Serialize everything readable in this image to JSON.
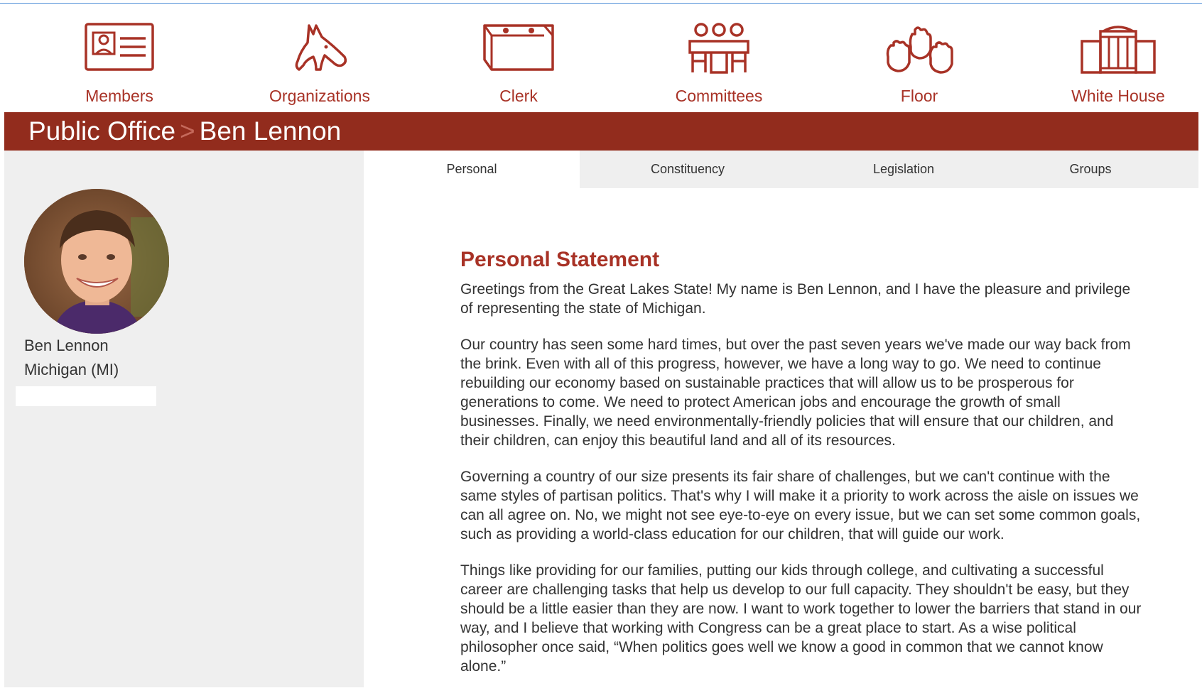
{
  "nav": {
    "items": [
      {
        "label": "Members",
        "icon": "id-card-icon"
      },
      {
        "label": "Organizations",
        "icon": "donkey-icon"
      },
      {
        "label": "Clerk",
        "icon": "file-box-icon"
      },
      {
        "label": "Committees",
        "icon": "committee-icon"
      },
      {
        "label": "Floor",
        "icon": "raised-hands-icon"
      },
      {
        "label": "White House",
        "icon": "building-icon"
      }
    ]
  },
  "title_bar": {
    "section": "Public Office",
    "separator": ">",
    "member": "Ben Lennon"
  },
  "sidebar": {
    "name": "Ben Lennon",
    "state": "Michigan (MI)"
  },
  "tabs": [
    {
      "label": "Personal",
      "active": true
    },
    {
      "label": "Constituency",
      "active": false
    },
    {
      "label": "Legislation",
      "active": false
    },
    {
      "label": "Groups",
      "active": false
    }
  ],
  "main": {
    "heading": "Personal Statement",
    "paragraphs": [
      "Greetings from the Great Lakes State! My name is Ben Lennon, and I have the pleasure and privilege of representing the state of Michigan.",
      "Our country has seen some hard times, but over the past seven years we've made our way back from the brink. Even with all of this progress, however, we have a long way to go. We need to continue rebuilding our economy based on sustainable practices that will allow us to be prosperous for generations to come. We need to protect American jobs and encourage the growth of small businesses. Finally, we need environmentally-friendly policies that will ensure that our children, and their children, can enjoy this beautiful land and all of its resources.",
      "Governing a country of our size presents its fair share of challenges, but we can't continue with the same styles of partisan politics. That's why I will make it a priority to work across the aisle on issues we can all agree on. No, we might not see eye-to-eye on every issue, but we can set some common goals, such as providing a world-class education for our children, that will guide our work.",
      "Things like providing for our families, putting our kids through college, and cultivating a successful career are challenging tasks that help us develop to our full capacity. They shouldn't be easy, but they should be a little easier than they are now. I want to work together to lower the barriers that stand in our way, and I believe that working with Congress can be a great place to start. As a wise political philosopher once said, “When politics goes well we know a good in common that we cannot know alone.”"
    ]
  },
  "colors": {
    "accent": "#a83226",
    "title_bar": "#922c1d",
    "sidebar_bg": "#efefef"
  }
}
